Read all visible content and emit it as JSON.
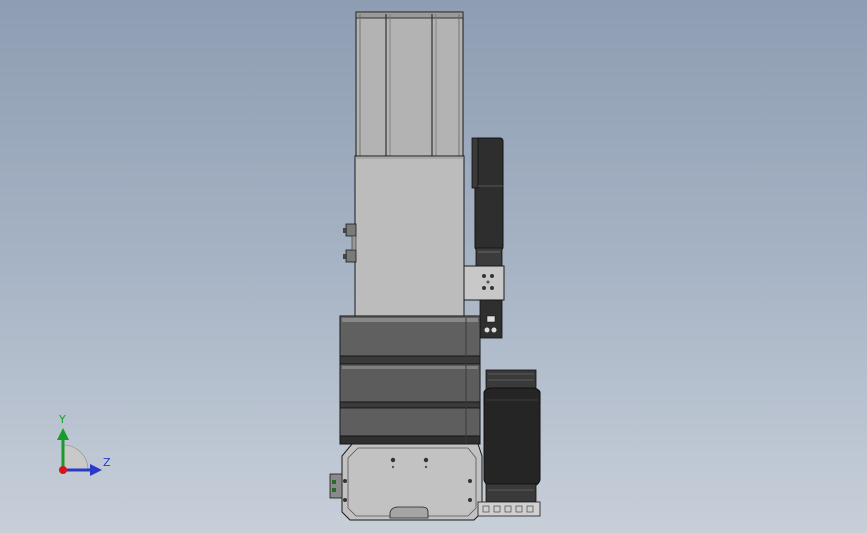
{
  "viewport": {
    "background_top": "#8e9db2",
    "background_bottom": "#c7cfd9"
  },
  "triad": {
    "y_label": "Y",
    "z_label": "Z",
    "y_color": "#1a9a2a",
    "z_color": "#2a3ac8",
    "x_color": "#d01818"
  },
  "model": {
    "body_color": "#b6b6b6",
    "dark_color": "#2b2b2b",
    "edge_color": "#1a1a1a"
  }
}
